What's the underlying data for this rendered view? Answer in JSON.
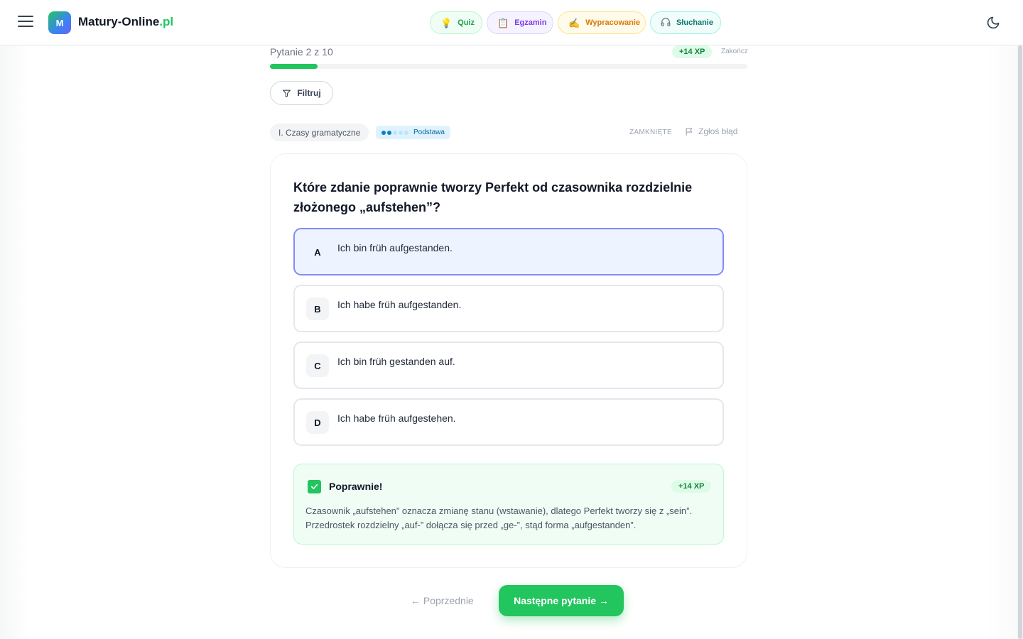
{
  "header": {
    "logo_letter": "M",
    "logo_name": "Matury-Online",
    "logo_tld": ".pl",
    "modes": [
      {
        "label": "Quiz",
        "icon": "lightbulb-icon",
        "color": "#16a34a"
      },
      {
        "label": "Egzamin",
        "icon": "clipboard-icon",
        "color": "#7c3aed"
      },
      {
        "label": "Wypracowanie",
        "icon": "writing-hand-icon",
        "color": "#d97706"
      },
      {
        "label": "Słuchanie",
        "icon": "headphones-icon",
        "color": "#0f766e"
      }
    ]
  },
  "progress": {
    "label": "Pytanie 2 z 10",
    "current": 2,
    "total": 10,
    "fill_fraction": 0.1,
    "xp": "+14 XP",
    "finish_label": "Zakończ"
  },
  "filter": {
    "label": "Filtruj"
  },
  "meta": {
    "topic": "I. Czasy gramatyczne",
    "level": "Podstawa",
    "level_dots_on": 2,
    "level_dots_total": 5,
    "type": "ZAMKNIĘTE",
    "report": "Zgłoś błąd"
  },
  "question": {
    "text": "Które zdanie poprawnie tworzy Perfekt od czasownika rozdzielnie złożonego „aufstehen”?",
    "options": [
      {
        "letter": "A",
        "text": "Ich bin früh aufgestanden.",
        "selected": true
      },
      {
        "letter": "B",
        "text": "Ich habe früh aufgestanden.",
        "selected": false
      },
      {
        "letter": "C",
        "text": "Ich bin früh gestanden auf.",
        "selected": false
      },
      {
        "letter": "D",
        "text": "Ich habe früh aufgestehen.",
        "selected": false
      }
    ]
  },
  "feedback": {
    "title": "Poprawnie!",
    "xp": "+14 XP",
    "text": "Czasownik „aufstehen” oznacza zmianę stanu (wstawanie), dlatego Perfekt tworzy się z „sein”. Przedrostek rozdzielny „auf-” dołącza się przed „ge-”, stąd forma „aufgestanden”."
  },
  "nav": {
    "prev": "← Poprzednie",
    "next": "Następne pytanie →"
  },
  "colors": {
    "accent": "#22c55e",
    "selected_border": "#818cf8"
  }
}
